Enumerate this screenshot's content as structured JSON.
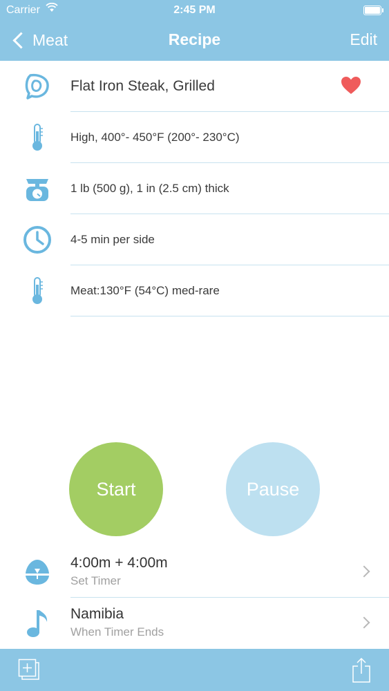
{
  "status_bar": {
    "carrier": "Carrier",
    "time": "2:45 PM"
  },
  "nav": {
    "back_label": "Meat",
    "title": "Recipe",
    "edit_label": "Edit"
  },
  "recipe": {
    "name": "Flat Iron Steak, Grilled",
    "heat": "High, 400°- 450°F (200°- 230°C)",
    "size": "1 lb (500 g), 1 in (2.5 cm) thick",
    "time": "4-5 min per side",
    "doneness": "Meat:130°F (54°C) med-rare"
  },
  "controls": {
    "start_label": "Start",
    "pause_label": "Pause"
  },
  "timer": {
    "value": "4:00m + 4:00m",
    "caption": "Set Timer"
  },
  "sound": {
    "value": "Namibia",
    "caption": "When Timer Ends"
  },
  "colors": {
    "bar": "#8cc6e4",
    "icon": "#6ab7df",
    "start": "#a3cd63",
    "pause": "#bde0f0",
    "heart": "#ef5b5b"
  },
  "icons": {
    "meat": "steak-icon",
    "heat": "thermometer-icon",
    "size": "scale-icon",
    "time": "clock-icon",
    "doneness": "thermometer-icon",
    "timer": "egg-timer-icon",
    "sound": "music-note-icon",
    "favorite": "heart-icon",
    "add": "add-icon",
    "share": "share-icon"
  }
}
